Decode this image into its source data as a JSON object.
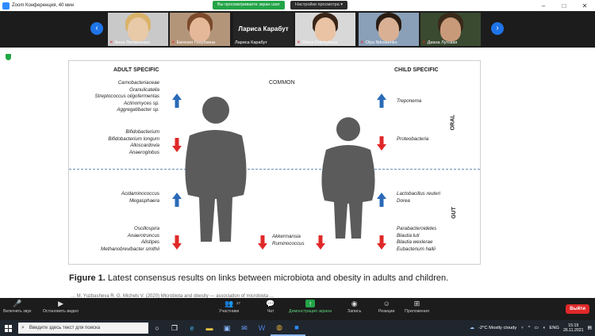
{
  "window": {
    "title": "Zoom Конференция, 40 мин",
    "share_status": "Вы просматриваете экран user",
    "view_options": "Настройки просмотра",
    "controls": [
      "–",
      "□",
      "✕"
    ]
  },
  "participants": [
    {
      "name": "Анна Литвиненко",
      "muted": true,
      "skin": "#e8c9a8",
      "hair": "#d9b36a",
      "bg": "#c9c9c9"
    },
    {
      "name": "Евгения Голубкина",
      "muted": true,
      "skin": "#e5b89a",
      "hair": "#7a4a2a",
      "bg": "#b3967a"
    },
    {
      "name": "Лариса Карабут",
      "muted": false,
      "plain": true,
      "big": "Лариса Карабут"
    },
    {
      "name": "Olena Dolzhykova",
      "muted": true,
      "skin": "#eac2a4",
      "hair": "#3a2618",
      "bg": "#d8d8d8"
    },
    {
      "name": "Olya Nikolaenko",
      "muted": true,
      "skin": "#d9b094",
      "hair": "#2a1d14",
      "bg": "#8aa0b8"
    },
    {
      "name": "Диана Луговая",
      "muted": true,
      "skin": "#c99a7a",
      "hair": "#3a2a1a",
      "bg": "#3a4a30"
    }
  ],
  "figure": {
    "adult_header": "ADULT SPECIFIC",
    "child_header": "CHILD SPECIFIC",
    "common_header": "COMMON",
    "oral_label": "ORAL",
    "gut_label": "GUT",
    "adult_oral_up": [
      "Carnobacteriaceae",
      "Granulicatella",
      "Streptococcus oligofermentas",
      "Actinomyces sp.",
      "Aggregatibacter sp."
    ],
    "adult_oral_down": [
      "Bifidobacterium",
      "Bifidobacterium longum",
      "Alloscardovia",
      "Anaeroglobus"
    ],
    "adult_gut_up": [
      "Acidaminococcus",
      "Megasphaera"
    ],
    "adult_gut_down": [
      "Oscillospira",
      "Anaerotruncus",
      "Alistipes",
      "Methanobrevibacter smithii"
    ],
    "common_gut_down": [
      "Akkermansia",
      "Ruminococcus"
    ],
    "child_oral_up": [
      "Treponema"
    ],
    "child_oral_down": [
      "Proteobacteria"
    ],
    "child_gut_up": [
      "Lactobacillus reuteri",
      "Dorea"
    ],
    "child_gut_down": [
      "Parabacteroidetes",
      "Blautia luti",
      "Blautia wexlerae",
      "Eubacterium hallii"
    ],
    "colors": {
      "up": "#2a6ab8",
      "down": "#e02828",
      "silhouette": "#5b5b5b"
    },
    "caption_bold": "Figure 1.",
    "caption_text": "Latest consensus results on links between microbiota and obesity in adults and children.",
    "reference": "... M. Yuzbasheva R. G. Michels V. (2020) Microbiota and obesity — association of microbiota ..."
  },
  "toolbar": {
    "unmute": "Включить звук",
    "stop_video": "Остановить видео",
    "participants": "Участники",
    "participants_count": "27",
    "chat": "Чат",
    "share": "Демонстрация экрана",
    "record": "Запись",
    "reactions": "Реакции",
    "apps": "Приложения",
    "leave": "Выйти"
  },
  "taskbar": {
    "search_placeholder": "Введите здесь текст для поиска",
    "weather": "-2°C  Mostly cloudy",
    "lang": "ENG",
    "time": "15:19",
    "date": "26.11.2021"
  }
}
